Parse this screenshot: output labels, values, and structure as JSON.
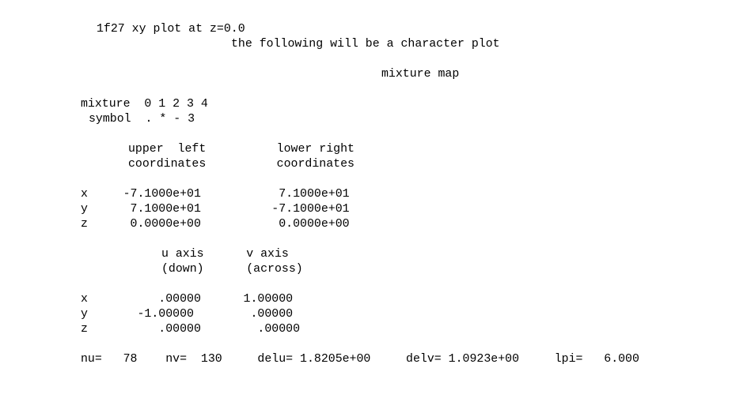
{
  "document": {
    "title_line": "1f27 xy plot at z=0.0",
    "subtitle_line": "the following will be a character plot",
    "map_title": "mixture map",
    "mixture_row": "mixture  0 1 2 3 4",
    "symbol_row": "symbol  . * - 3",
    "corner_header_1": "upper  left          lower right",
    "corner_header_2": "coordinates          coordinates",
    "coord_x": "x     -7.1000e+01           7.1000e+01",
    "coord_y": "y      7.1000e+01          -7.1000e+01",
    "coord_z": "z      0.0000e+00           0.0000e+00",
    "axis_header_1": "u axis      v axis",
    "axis_header_2": "(down)      (across)",
    "axis_x": "x          .00000      1.00000",
    "axis_y": "y       -1.00000        .00000",
    "axis_z": "z          .00000        .00000",
    "params_row": "nu=   78    nv=  130     delu= 1.8205e+00     delv= 1.0923e+00     lpi=   6.000"
  }
}
